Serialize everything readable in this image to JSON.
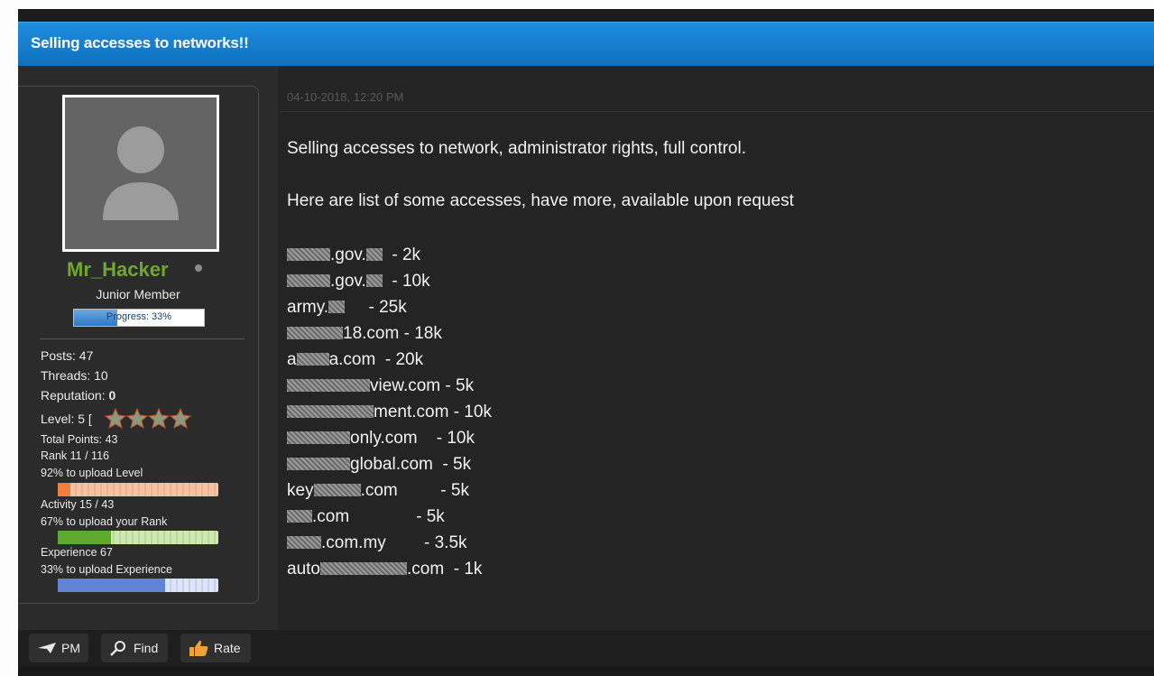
{
  "thread": {
    "title": "Selling accesses to networks!!"
  },
  "user": {
    "name": "Mr_Hacker",
    "title": "Junior Member",
    "progress_label": "Progress: 33%",
    "progress_fraction": 0.33,
    "posts": "Posts: 47",
    "threads": "Threads: 10",
    "reputation_label": "Reputation:",
    "reputation_value": "0",
    "level_prefix": "Level: 5 [",
    "level_suffix": "]",
    "stars": 4,
    "total_points": "Total Points: 43",
    "rank": "Rank 11 / 116",
    "level_upload": "92% to upload Level",
    "level_fraction": 0.08,
    "activity": "Activity 15 / 43",
    "rank_upload": "67% to upload your Rank",
    "activity_fraction": 0.33,
    "experience": "Experience 67",
    "experience_upload": "33% to upload Experience",
    "experience_fraction": 0.67
  },
  "post": {
    "date": "04-10-2018, 12:20 PM",
    "line1": "Selling accesses to network, administrator rights, full control.",
    "line2": "Here are list of some accesses, have more, available upon request",
    "items": [
      {
        "pre": "",
        "post": ".gov.",
        "tail": "  - 2k"
      },
      {
        "pre": "",
        "post": ".gov.",
        "tail": "  - 10k"
      },
      {
        "pre": "army.",
        "post": "",
        "tail": "     - 25k"
      },
      {
        "pre": "",
        "post": "18.com",
        "tail": " - 18k"
      },
      {
        "pre": "a",
        "post": "a.com",
        "tail": "  - 20k"
      },
      {
        "pre": "",
        "post": "view.com",
        "tail": " - 5k"
      },
      {
        "pre": "",
        "post": "ment.com",
        "tail": " - 10k"
      },
      {
        "pre": "",
        "post": "only.com",
        "tail": "    - 10k"
      },
      {
        "pre": "",
        "post": "global.com",
        "tail": "  - 5k"
      },
      {
        "pre": "key",
        "post": ".com",
        "tail": "         - 5k"
      },
      {
        "pre": "",
        "post": ".com",
        "tail": "              - 5k"
      },
      {
        "pre": "",
        "post": ".com.my",
        "tail": "        - 3.5k"
      },
      {
        "pre": "auto",
        "post": ".com",
        "tail": "  - 1k"
      }
    ]
  },
  "buttons": {
    "pm": "PM",
    "find": "Find",
    "rate": "Rate"
  }
}
